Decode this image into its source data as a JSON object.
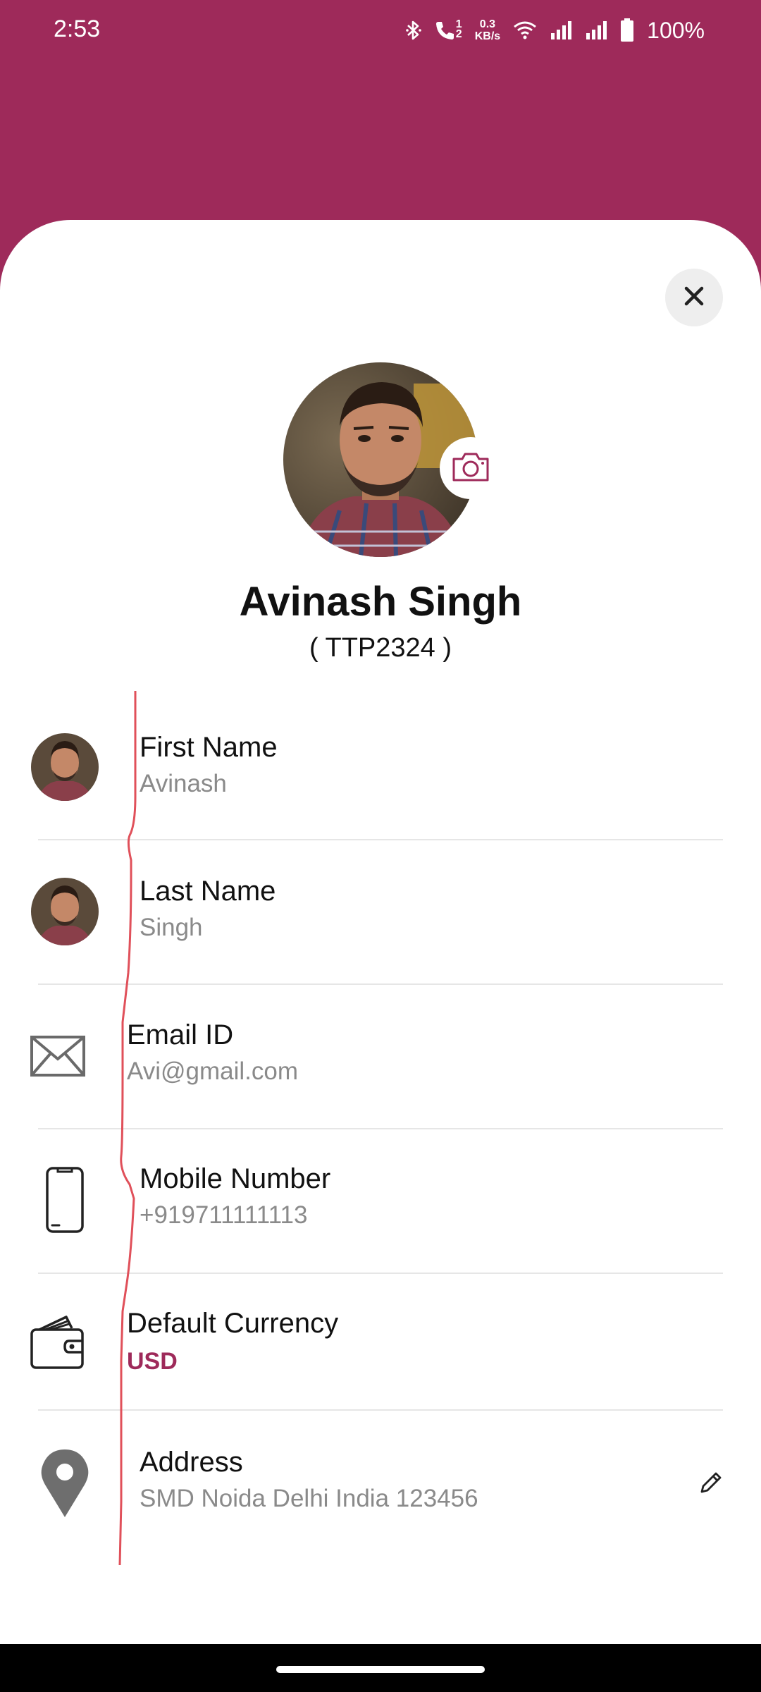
{
  "status_bar": {
    "time": "2:53",
    "speed_value": "0.3",
    "speed_unit": "KB/s",
    "call_sim": "1",
    "call_sim2": "2",
    "battery": "100%",
    "icons": [
      "bluetooth-icon",
      "call-icon",
      "wifi-icon",
      "signal-icon",
      "signal-icon",
      "battery-icon"
    ]
  },
  "profile": {
    "name": "Avinash Singh",
    "code": "( TTP2324 )"
  },
  "fields": [
    {
      "label": "First Name",
      "value": "Avinash",
      "icon": "avatar"
    },
    {
      "label": "Last Name",
      "value": "Singh",
      "icon": "avatar"
    },
    {
      "label": "Email ID",
      "value": "Avi@gmail.com",
      "icon": "envelope-icon"
    },
    {
      "label": "Mobile Number",
      "value": "+919711111113",
      "icon": "phone-icon"
    },
    {
      "label": "Default Currency",
      "value": "USD",
      "icon": "wallet-icon"
    },
    {
      "label": "Address",
      "value": "SMD Noida Delhi India 123456",
      "icon": "location-pin-icon"
    }
  ],
  "colors": {
    "brand": "#9e2a5a",
    "annotation": "#e0505a",
    "muted_text": "#8a8a8a"
  }
}
